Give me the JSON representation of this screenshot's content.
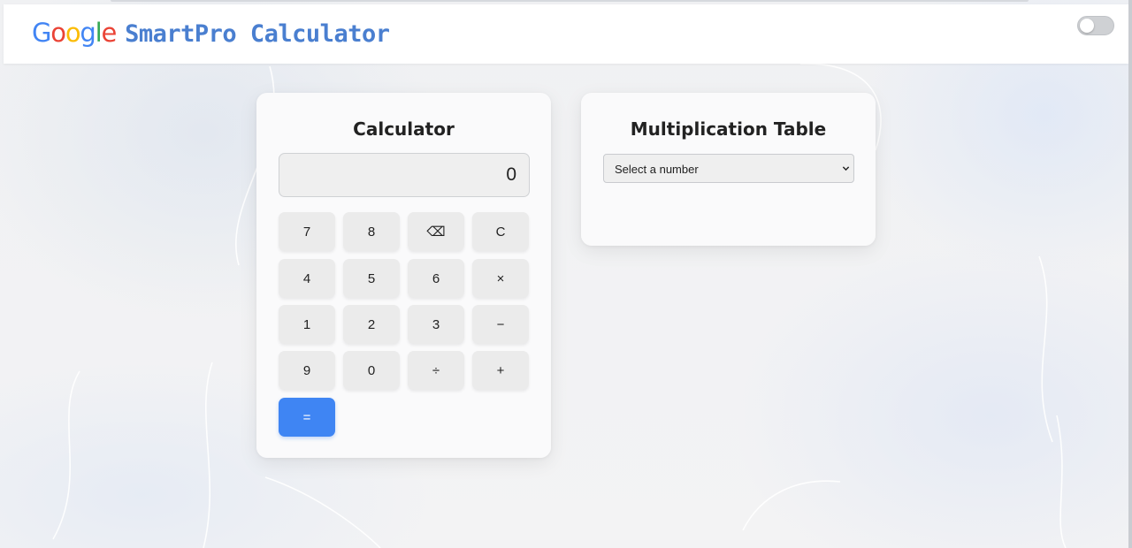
{
  "header": {
    "logo_google": "Google",
    "app_title": "SmartPro Calculator",
    "theme_toggle_on": false
  },
  "colors": {
    "accent": "#3f85f3",
    "google_blue": "#4285f4",
    "google_red": "#ea4335",
    "google_yellow": "#fbbc05",
    "google_green": "#34a853",
    "title_blue": "#4a7fd0"
  },
  "calculator": {
    "title": "Calculator",
    "display_value": "0",
    "keys": [
      {
        "label": "7",
        "name": "key-7"
      },
      {
        "label": "8",
        "name": "key-8"
      },
      {
        "label": "⌫",
        "name": "backspace-button"
      },
      {
        "label": "C",
        "name": "clear-button"
      },
      {
        "label": "4",
        "name": "key-4"
      },
      {
        "label": "5",
        "name": "key-5"
      },
      {
        "label": "6",
        "name": "key-6"
      },
      {
        "label": "×",
        "name": "multiply-button"
      },
      {
        "label": "1",
        "name": "key-1"
      },
      {
        "label": "2",
        "name": "key-2"
      },
      {
        "label": "3",
        "name": "key-3"
      },
      {
        "label": "−",
        "name": "subtract-button"
      },
      {
        "label": "9",
        "name": "key-9"
      },
      {
        "label": "0",
        "name": "key-0"
      },
      {
        "label": "÷",
        "name": "divide-button"
      },
      {
        "label": "+",
        "name": "add-button"
      },
      {
        "label": "=",
        "name": "equals-button"
      }
    ]
  },
  "multiplication_table": {
    "title": "Multiplication Table",
    "select_placeholder": "Select a number"
  }
}
